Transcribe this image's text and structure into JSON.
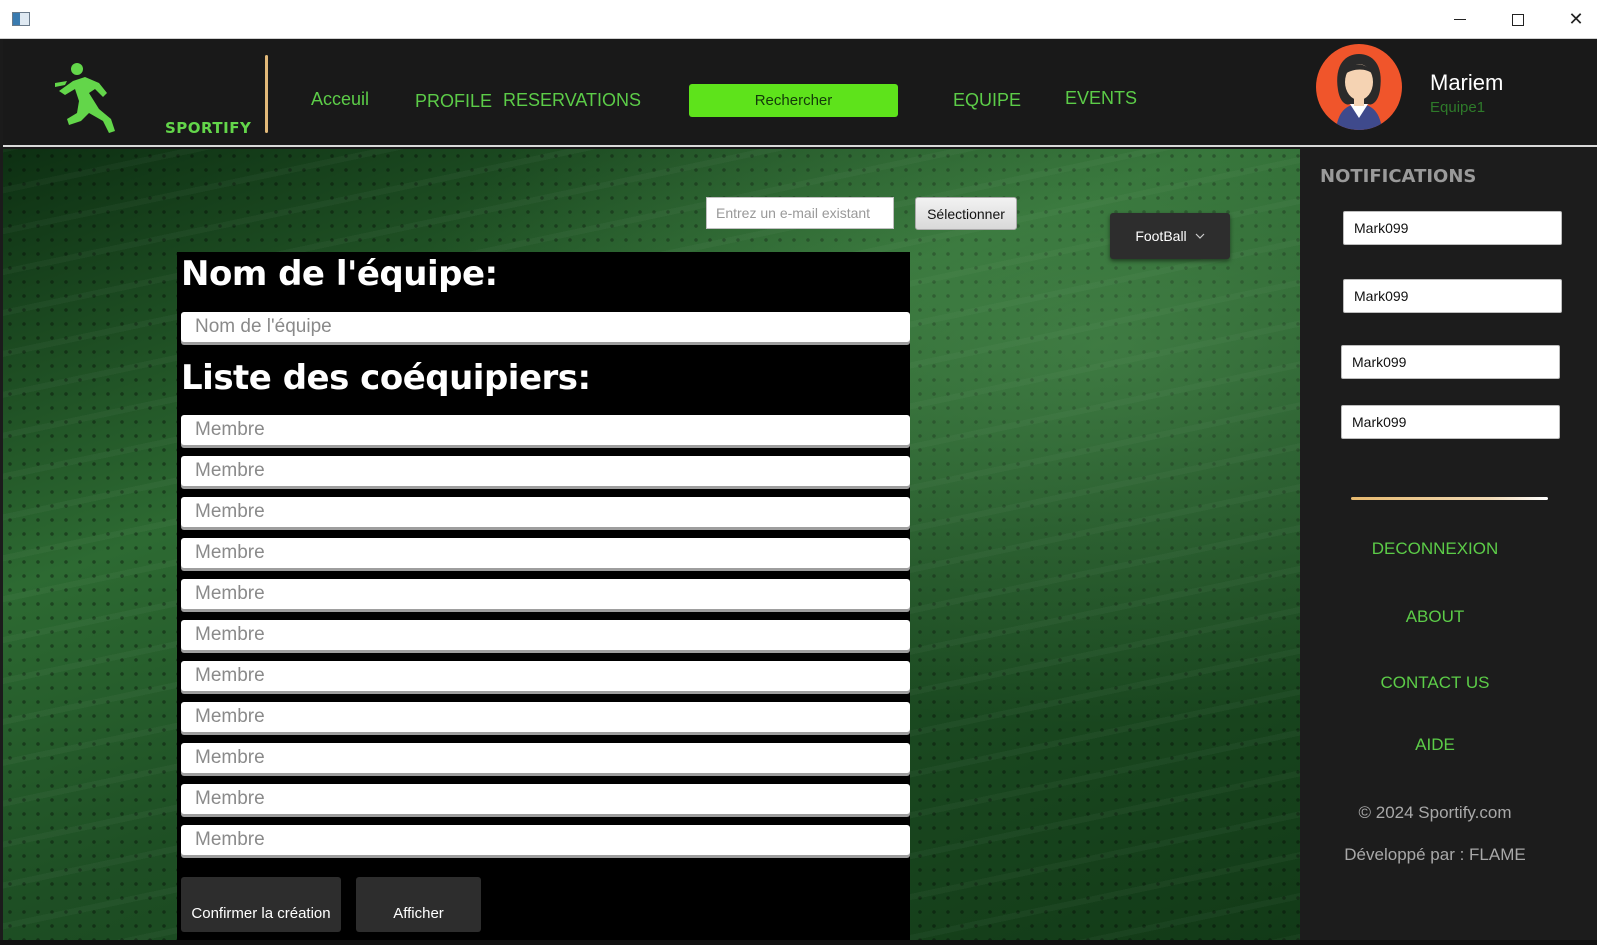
{
  "window": {
    "close_glyph": "✕"
  },
  "header": {
    "logo_text": "SPORTIFY",
    "nav": {
      "acceuil": "Acceuil",
      "profile": "PROFILE",
      "reservations": "RESERVATIONS",
      "rechercher": "Rechercher",
      "equipe": "EQUIPE",
      "events": "EVENTS"
    },
    "user": {
      "name": "Mariem",
      "team": "Equipe1"
    }
  },
  "main": {
    "email_placeholder": "Entrez un e-mail existant",
    "select_label": "Sélectionner",
    "sport": {
      "selected": "FootBall",
      "icon": "chevron-down-icon"
    },
    "form": {
      "team_name_title": "Nom de l'équipe:",
      "team_name_placeholder": "Nom de l'équipe",
      "members_title": "Liste des coéquipiers:",
      "member_placeholders": [
        "Membre",
        "Membre",
        "Membre",
        "Membre",
        "Membre",
        "Membre",
        "Membre",
        "Membre",
        "Membre",
        "Membre",
        "Membre"
      ],
      "confirm_label": "Confirmer la création",
      "show_label": "Afficher"
    }
  },
  "sidebar": {
    "notifications_title": "NOTIFICATIONS",
    "notifications": [
      "Mark099",
      "Mark099",
      "Mark099",
      "Mark099"
    ],
    "links": {
      "deconnexion": "DECONNEXION",
      "about": "ABOUT",
      "contact": "CONTACT US",
      "aide": "AIDE"
    },
    "copyright": "© 2024 Sportify.com",
    "developer": "Développé par :  FLAME"
  },
  "colors": {
    "accent_green": "#5ccc48",
    "button_green": "#5ee31b",
    "divider_gold": "#e2b979"
  }
}
